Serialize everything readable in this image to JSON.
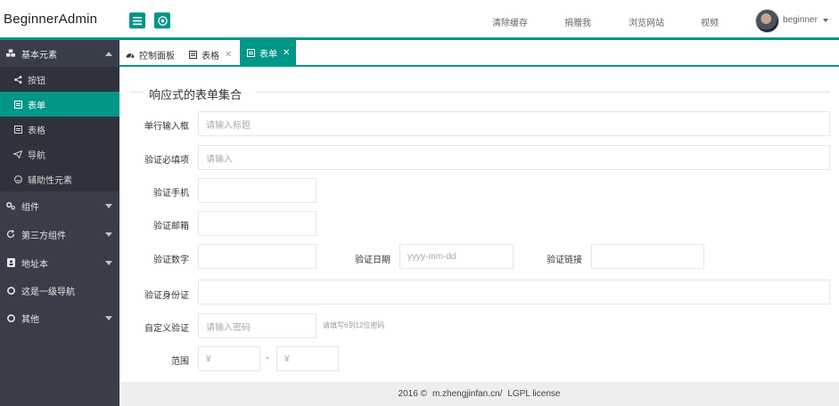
{
  "header": {
    "app_title": "BeginnerAdmin",
    "menu_icon": "menu-icon",
    "home_icon": "globe-icon",
    "nav": [
      "清除缓存",
      "捐赠我",
      "浏览网站",
      "视频"
    ],
    "username": "beginner",
    "accent_color": "#009688"
  },
  "sidebar": {
    "background": "#393d49",
    "items": [
      {
        "label": "基本元素",
        "icon": "cubes-icon",
        "expanded": true,
        "children": [
          {
            "label": "按钮",
            "icon": "share-icon",
            "active": false
          },
          {
            "label": "表单",
            "icon": "form-icon",
            "active": true
          },
          {
            "label": "表格",
            "icon": "table-icon",
            "active": false
          },
          {
            "label": "导航",
            "icon": "send-icon",
            "active": false
          },
          {
            "label": "辅助性元素",
            "icon": "smile-icon",
            "active": false
          }
        ]
      },
      {
        "label": "组件",
        "icon": "cogs-icon"
      },
      {
        "label": "第三方组件",
        "icon": "refresh-icon"
      },
      {
        "label": "地址本",
        "icon": "address-book-icon"
      },
      {
        "label": "这是一级导航",
        "icon": "circle-icon"
      },
      {
        "label": "其他",
        "icon": "circle-icon"
      }
    ]
  },
  "tabs": [
    {
      "label": "控制面板",
      "icon": "dashboard-icon",
      "closable": false,
      "active": false
    },
    {
      "label": "表格",
      "icon": "table-icon",
      "closable": true,
      "active": false
    },
    {
      "label": "表单",
      "icon": "form-icon",
      "closable": true,
      "active": true
    }
  ],
  "form": {
    "legend": "响应式的表单集合",
    "fields": {
      "title": {
        "label": "单行输入框",
        "placeholder": "请输入标题"
      },
      "required": {
        "label": "验证必填项",
        "placeholder": "请输入"
      },
      "phone": {
        "label": "验证手机",
        "placeholder": ""
      },
      "email": {
        "label": "验证邮箱",
        "placeholder": ""
      },
      "number": {
        "label": "验证数字",
        "placeholder": ""
      },
      "date": {
        "label": "验证日期",
        "placeholder": "yyyy-mm-dd"
      },
      "url": {
        "label": "验证链接",
        "placeholder": ""
      },
      "id_card": {
        "label": "验证身份证",
        "placeholder": ""
      },
      "custom": {
        "label": "自定义验证",
        "placeholder": "请输入密码",
        "hint": "请填写6到12位密码"
      },
      "range": {
        "label": "范围",
        "min_placeholder": "¥",
        "max_placeholder": "¥",
        "separator": "-"
      }
    }
  },
  "footer": {
    "year": "2016 ©",
    "site": "m.zhengjinfan.cn/",
    "license": "LGPL license"
  }
}
